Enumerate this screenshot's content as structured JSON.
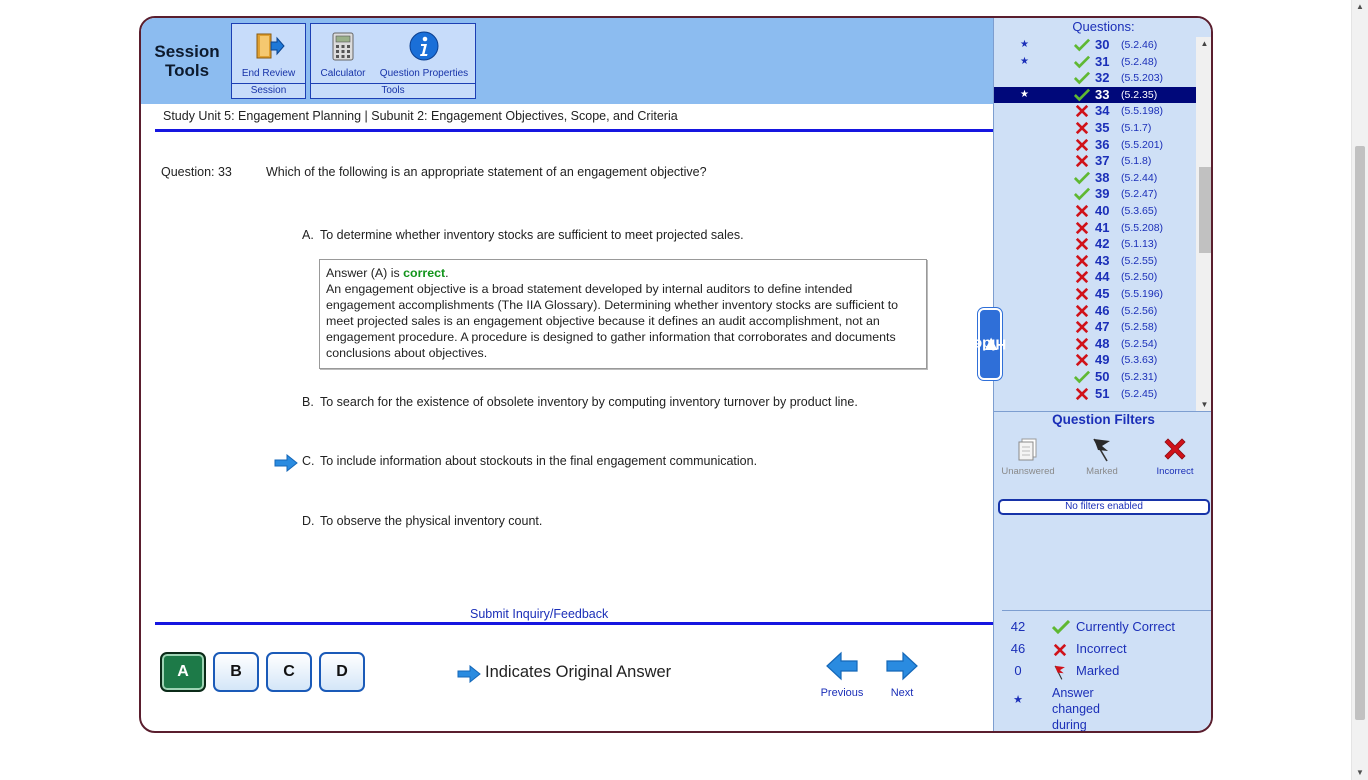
{
  "toolbar": {
    "section_title": "Session\nTools",
    "end_review_label": "End Review",
    "session_caption": "Session",
    "calculator_label": "Calculator",
    "question_properties_label": "Question Properties",
    "tools_caption": "Tools"
  },
  "breadcrumb": "Study Unit 5: Engagement Planning | Subunit 2: Engagement Objectives, Scope, and Criteria",
  "question": {
    "label": "Question: 33",
    "text": "Which of the following is an appropriate statement of an engagement objective?"
  },
  "choices": [
    {
      "letter": "A.",
      "text": "To determine whether inventory stocks are sufficient to meet projected sales."
    },
    {
      "letter": "B.",
      "text": "To search for the existence of obsolete inventory by computing inventory turnover by product line."
    },
    {
      "letter": "C.",
      "text": "To include information about stockouts in the final engagement communication."
    },
    {
      "letter": "D.",
      "text": "To observe the physical inventory count."
    }
  ],
  "explanation": {
    "prefix": "Answer (A) is ",
    "verdict": "correct",
    "suffix": ".",
    "body": "An engagement objective is a broad statement developed by internal auditors to define intended engagement accomplishments (The IIA Glossary). Determining whether inventory stocks are sufficient to meet projected sales is an engagement objective because it defines an audit accomplishment, not an engagement procedure. A procedure is designed to gather information that corroborates and documents conclusions about objectives."
  },
  "inquiry_link": "Submit Inquiry/Feedback",
  "answer_buttons": [
    "A",
    "B",
    "C",
    "D"
  ],
  "selected_answer": "A",
  "original_answer_legend": "Indicates Original Answer",
  "nav": {
    "previous": "Previous",
    "next": "Next"
  },
  "hide_tab": "Hide",
  "questions_panel": {
    "title": "Questions:",
    "items": [
      {
        "num": "30",
        "ref": "(5.2.46)",
        "status": "correct",
        "changed": true
      },
      {
        "num": "31",
        "ref": "(5.2.48)",
        "status": "correct",
        "changed": true
      },
      {
        "num": "32",
        "ref": "(5.5.203)",
        "status": "correct",
        "changed": false
      },
      {
        "num": "33",
        "ref": "(5.2.35)",
        "status": "correct",
        "changed": true,
        "selected": true
      },
      {
        "num": "34",
        "ref": "(5.5.198)",
        "status": "incorrect",
        "changed": false
      },
      {
        "num": "35",
        "ref": "(5.1.7)",
        "status": "incorrect",
        "changed": false
      },
      {
        "num": "36",
        "ref": "(5.5.201)",
        "status": "incorrect",
        "changed": false
      },
      {
        "num": "37",
        "ref": "(5.1.8)",
        "status": "incorrect",
        "changed": false
      },
      {
        "num": "38",
        "ref": "(5.2.44)",
        "status": "correct",
        "changed": false
      },
      {
        "num": "39",
        "ref": "(5.2.47)",
        "status": "correct",
        "changed": false
      },
      {
        "num": "40",
        "ref": "(5.3.65)",
        "status": "incorrect",
        "changed": false
      },
      {
        "num": "41",
        "ref": "(5.5.208)",
        "status": "incorrect",
        "changed": false
      },
      {
        "num": "42",
        "ref": "(5.1.13)",
        "status": "incorrect",
        "changed": false
      },
      {
        "num": "43",
        "ref": "(5.2.55)",
        "status": "incorrect",
        "changed": false
      },
      {
        "num": "44",
        "ref": "(5.2.50)",
        "status": "incorrect",
        "changed": false
      },
      {
        "num": "45",
        "ref": "(5.5.196)",
        "status": "incorrect",
        "changed": false
      },
      {
        "num": "46",
        "ref": "(5.2.56)",
        "status": "incorrect",
        "changed": false
      },
      {
        "num": "47",
        "ref": "(5.2.58)",
        "status": "incorrect",
        "changed": false
      },
      {
        "num": "48",
        "ref": "(5.2.54)",
        "status": "incorrect",
        "changed": false
      },
      {
        "num": "49",
        "ref": "(5.3.63)",
        "status": "incorrect",
        "changed": false
      },
      {
        "num": "50",
        "ref": "(5.2.31)",
        "status": "correct",
        "changed": false
      },
      {
        "num": "51",
        "ref": "(5.2.45)",
        "status": "incorrect",
        "changed": false
      }
    ]
  },
  "filters": {
    "title": "Question Filters",
    "unanswered": "Unanswered",
    "marked": "Marked",
    "incorrect": "Incorrect",
    "status": "No filters enabled"
  },
  "stats": {
    "correct_count": "42",
    "correct_label": "Currently Correct",
    "incorrect_count": "46",
    "incorrect_label": "Incorrect",
    "marked_count": "0",
    "marked_label": "Marked",
    "changed_label": "Answer changed\nduring review session"
  },
  "colors": {
    "accent_blue": "#1616e0",
    "header_blue": "#8cbcf0",
    "panel_bg": "#cfe0f6",
    "correct_green": "#12941b",
    "incorrect_red": "#d0121a"
  }
}
